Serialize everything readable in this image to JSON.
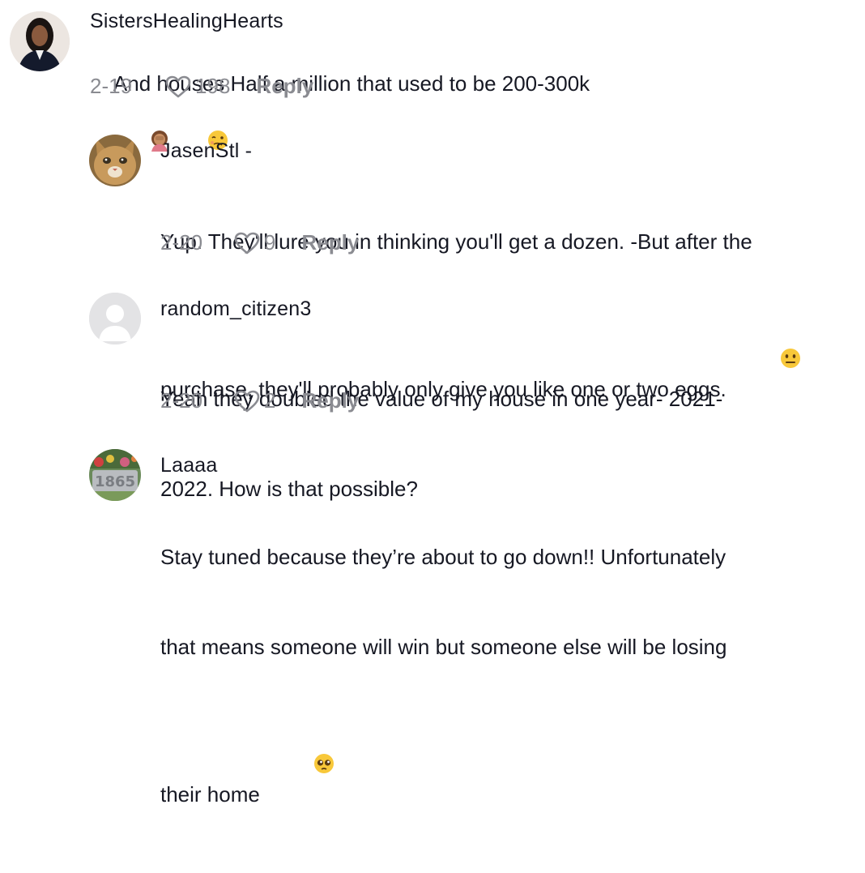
{
  "comments": [
    {
      "username": "SistersHealingHearts",
      "text": "And houses Half a million that used to be 200-300k",
      "date": "2-19",
      "likes": "198",
      "reply_label": "Reply",
      "emojis": [
        "woman-facepalming-emoji",
        "woozy-face-emoji"
      ]
    },
    {
      "username": "JasenStl -",
      "text_line1": "Yup. They'll lure you in thinking you'll get a dozen. -But after the",
      "text_line2": "purchase, they'll probably only give you like one or two eggs.",
      "date": "2-20",
      "likes": "9",
      "reply_label": "Reply",
      "emojis": [
        "neutral-face-emoji"
      ]
    },
    {
      "username": "random_citizen3",
      "text_line1": "Yeah they doubled the value of my house in one year- 2021-",
      "text_line2": "2022. How is that possible?",
      "date": "2-20",
      "likes": "2",
      "reply_label": "Reply"
    },
    {
      "username": "Laaaa",
      "text_line1": "Stay tuned because they’re about to go down!! Unfortunately",
      "text_line2": "that means someone will win but someone else will be losing",
      "text_line3": "their home",
      "emojis": [
        "pleading-face-emoji"
      ]
    }
  ],
  "colors": {
    "text": "#161823",
    "muted": "#8a8b91",
    "background": "#ffffff"
  }
}
